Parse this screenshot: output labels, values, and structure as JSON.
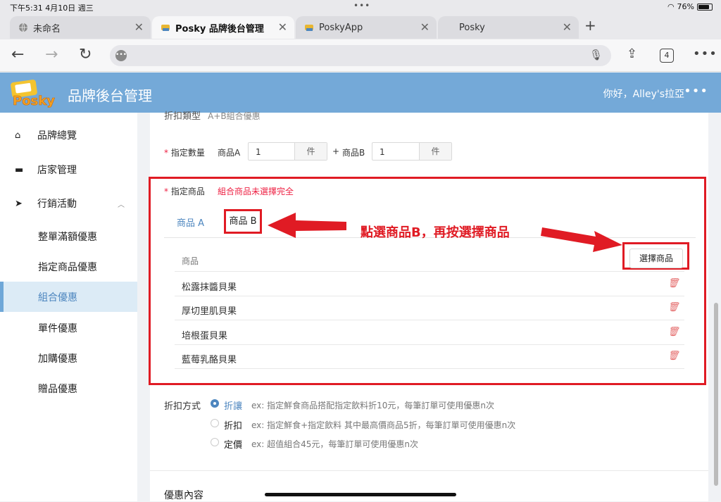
{
  "status_bar": {
    "time_date": "下午5:31  4月10日 週三",
    "battery": "76%"
  },
  "browser": {
    "tabs": [
      {
        "label": "未命名"
      },
      {
        "label": "Posky 品牌後台管理"
      },
      {
        "label": "PoskyApp"
      },
      {
        "label": "Posky"
      }
    ],
    "tab_count": "4"
  },
  "header": {
    "logo_text": "Posky",
    "title": "品牌後台管理",
    "greeting": "你好，Alley's拉亞"
  },
  "sidebar": {
    "items": [
      {
        "label": "品牌總覽",
        "icon": "home-icon"
      },
      {
        "label": "店家管理",
        "icon": "store-icon"
      },
      {
        "label": "行銷活動",
        "icon": "send-icon"
      }
    ],
    "sub_items": [
      "整單滿額優惠",
      "指定商品優惠",
      "組合優惠",
      "單件優惠",
      "加購優惠",
      "贈品優惠"
    ],
    "active_sub": "組合優惠"
  },
  "form": {
    "discount_type_label": "折扣類型",
    "discount_type_value": "A+B組合優惠",
    "quantity_label": "指定數量",
    "product_a_label": "商品A",
    "product_a_qty": "1",
    "plus": "+",
    "product_b_label": "商品B",
    "product_b_qty": "1",
    "unit": "件",
    "products_label": "指定商品",
    "products_error": "組合商品未選擇完全",
    "tab_a": "商品 A",
    "tab_b": "商品 B",
    "select_button": "選擇商品",
    "table_header": "商品",
    "rows": [
      "松露抹醬貝果",
      "厚切里肌貝果",
      "培根蛋貝果",
      "藍莓乳酪貝果"
    ],
    "discount_method_label": "折扣方式",
    "methods": [
      {
        "label": "折讓",
        "desc": "ex: 指定鮮食商品搭配指定飲料折10元，每筆訂單可使用優惠n次",
        "selected": true
      },
      {
        "label": "折扣",
        "desc": "ex: 指定鮮食+指定飲料 其中最高價商品5折，每筆訂單可使用優惠n次",
        "selected": false
      },
      {
        "label": "定價",
        "desc": "ex: 超值組合45元，每筆訂單可使用優惠n次",
        "selected": false
      }
    ],
    "next_section": "優惠內容"
  },
  "annotation": "點選商品B，再按選擇商品",
  "colors": {
    "accent": "#4d86bf",
    "header": "#74a9d8",
    "annotation_red": "#e01b24"
  }
}
